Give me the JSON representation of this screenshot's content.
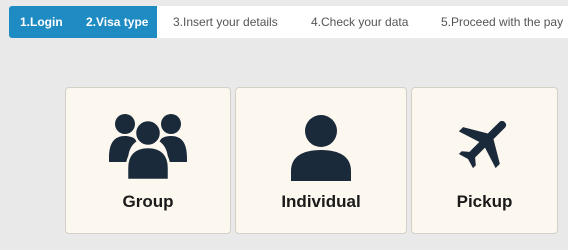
{
  "steps": [
    {
      "label": "1.Login",
      "active": true
    },
    {
      "label": "2.Visa type",
      "active": true
    },
    {
      "label": "3.Insert your details",
      "active": false
    },
    {
      "label": "4.Check your data",
      "active": false
    },
    {
      "label": "5.Proceed with the pay",
      "active": false
    }
  ],
  "options": {
    "group": {
      "label": "Group",
      "icon": "group-icon"
    },
    "individual": {
      "label": "Individual",
      "icon": "user-icon"
    },
    "pickup": {
      "label": "Pickup",
      "icon": "airplane-icon"
    }
  },
  "colors": {
    "accent": "#1f8bc3",
    "icon": "#1b2a3a",
    "card_bg": "#fdf8ef",
    "page_bg": "#e9e9e9"
  }
}
